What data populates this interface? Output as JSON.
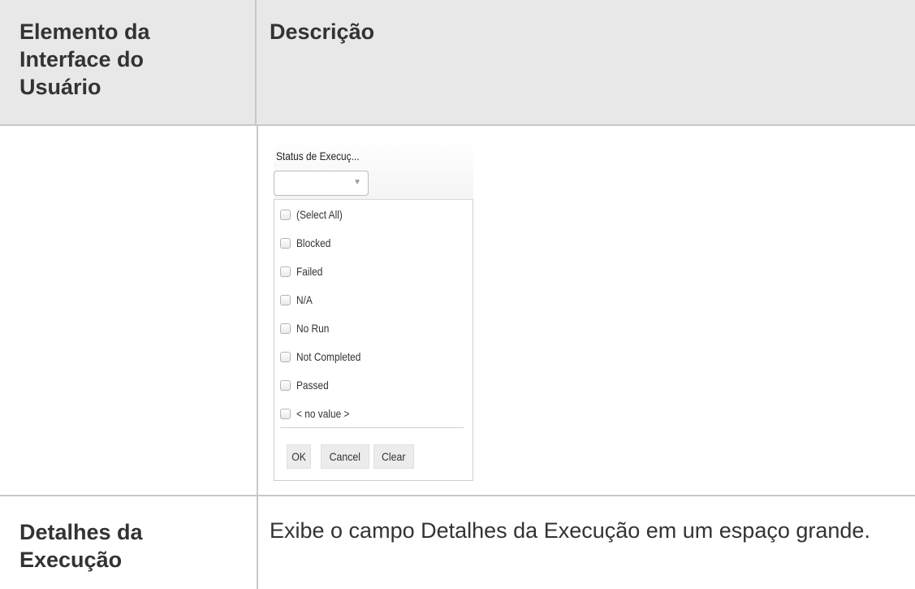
{
  "table": {
    "header": {
      "col1": "Elemento da Interface do Usuário",
      "col2": "Descrição"
    },
    "rows": [
      {
        "element": "",
        "widget": {
          "title": "Status de Execuç...",
          "combo_value": "",
          "arrow_icon": "chevron-down-icon",
          "options": [
            "(Select All)",
            "Blocked",
            "Failed",
            "N/A",
            "No Run",
            "Not Completed",
            "Passed",
            "< no value >"
          ],
          "buttons": {
            "ok": "OK",
            "cancel": "Cancel",
            "clear": "Clear"
          }
        }
      },
      {
        "element": "Detalhes da Execução",
        "description": "Exibe o campo Detalhes da Execução em um espaço grande."
      }
    ]
  }
}
